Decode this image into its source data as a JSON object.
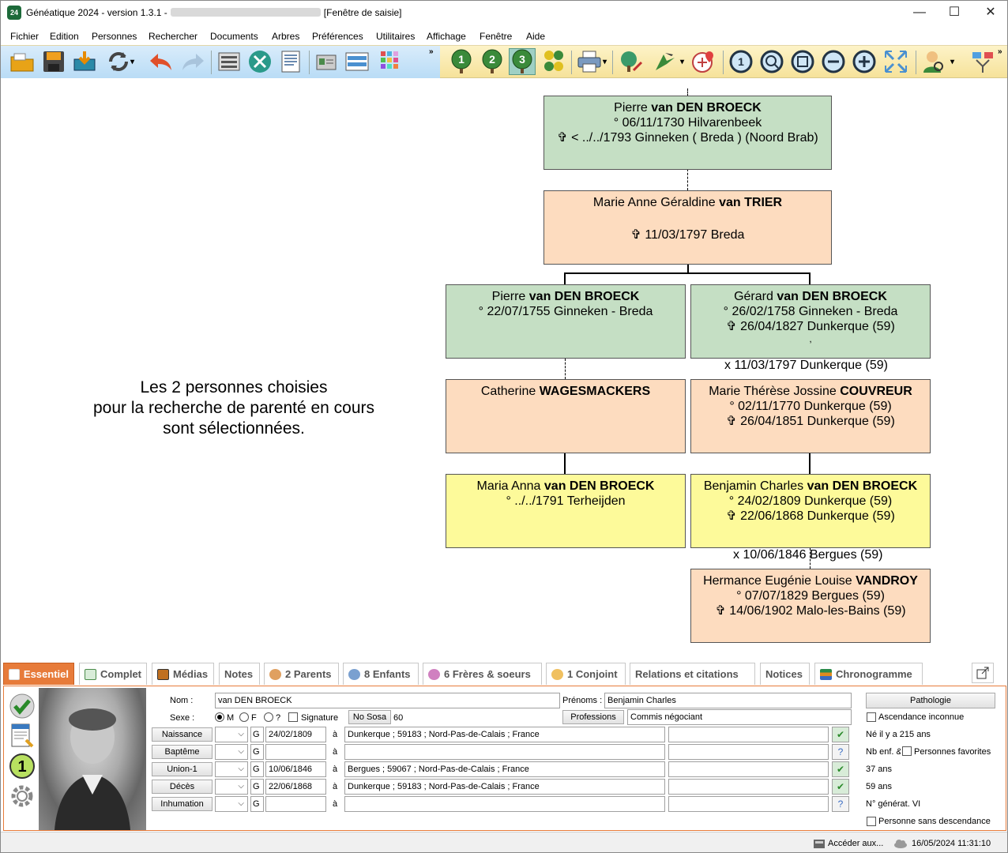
{
  "window": {
    "app_title": "Généatique 2024 - version 1.3.1 -",
    "title_suffix": "[Fenêtre de saisie]",
    "logo_text": "24",
    "minimize": "—",
    "maximize": "☐",
    "close": "✕"
  },
  "menu": [
    "Fichier",
    "Edition",
    "Personnes",
    "Rechercher",
    "Documents",
    "Arbres",
    "Préférences",
    "Utilitaires",
    "Affichage",
    "Fenêtre",
    "Aide"
  ],
  "toolbar": {
    "icons": [
      "open-folder-icon",
      "save-icon",
      "import-icon",
      "refresh-icon",
      "undo-icon",
      "redo-icon",
      "keyboard-icon",
      "tools-icon",
      "document-icon",
      "id-card-icon",
      "list-icon",
      "color-grid-icon",
      "generation-1-icon",
      "generation-2-icon",
      "generation-3-icon",
      "family-icon",
      "print-icon",
      "tree-edit-icon",
      "cursor-icon",
      "map-icon",
      "zoom-1-icon",
      "zoom-fit-icon",
      "zoom-frame-icon",
      "zoom-out-icon",
      "zoom-in-icon",
      "fullscreen-icon",
      "person-search-icon",
      "filter-icon"
    ],
    "overflow": "»",
    "gen1": "1",
    "gen2": "2",
    "gen3": "3"
  },
  "tree": {
    "persons": [
      {
        "first": "Pierre ",
        "last": "van DEN BROECK",
        "line2": "° 06/11/1730 Hilvarenbeek",
        "line3": "✞ < ../../1793 Ginneken ( Breda ) (Noord Brab)",
        "color": "green"
      },
      {
        "first": "Marie Anne Géraldine ",
        "last": "van TRIER",
        "line2": "",
        "line3": "✞ 11/03/1797 Breda",
        "color": "peach"
      },
      {
        "first": "Pierre ",
        "last": "van DEN BROECK",
        "line2": "° 22/07/1755 Ginneken - Breda",
        "line3": "",
        "color": "green"
      },
      {
        "first": "Gérard ",
        "last": "van DEN BROECK",
        "line2": "° 26/02/1758 Ginneken - Breda",
        "line3": "✞ 26/04/1827 Dunkerque (59)",
        "color": "green"
      },
      {
        "first": "Catherine ",
        "last": "WAGESMACKERS",
        "line2": "",
        "line3": "",
        "color": "peach"
      },
      {
        "first": "Marie Thérèse Jossine ",
        "last": "COUVREUR",
        "line2": "° 02/11/1770 Dunkerque (59)",
        "line3": "✞ 26/04/1851 Dunkerque (59)",
        "color": "peach"
      },
      {
        "first": "Maria Anna ",
        "last": "van DEN BROECK",
        "line2": "° ../../1791 Terheijden",
        "line3": "",
        "color": "yellow"
      },
      {
        "first": "Benjamin Charles ",
        "last": "van DEN BROECK",
        "line2": "° 24/02/1809 Dunkerque (59)",
        "line3": "✞ 22/06/1868 Dunkerque (59)",
        "color": "yellow"
      },
      {
        "first": "Hermance Eugénie Louise ",
        "last": "VANDROY",
        "line2": "° 07/07/1829 Bergues (59)",
        "line3": "✞ 14/06/1902 Malo-les-Bains (59)",
        "color": "peach"
      }
    ],
    "unions": [
      "x 11/03/1797 Dunkerque (59)",
      "x 10/06/1846 Bergues (59)"
    ],
    "comma": ",",
    "message": [
      "Les 2 personnes choisies",
      "pour la recherche de parenté en cours",
      "sont sélectionnées."
    ]
  },
  "tabs": [
    {
      "label": "Essentiel",
      "icon": "calendar-icon",
      "active": true
    },
    {
      "label": "Complet",
      "icon": "form-icon"
    },
    {
      "label": "Médias",
      "icon": "film-icon"
    },
    {
      "label": "Notes",
      "icon": ""
    },
    {
      "label": "2 Parents",
      "icon": "parents-icon"
    },
    {
      "label": "8 Enfants",
      "icon": "children-icon"
    },
    {
      "label": "6 Frères & soeurs",
      "icon": "siblings-icon"
    },
    {
      "label": "1 Conjoint",
      "icon": "spouse-icon"
    },
    {
      "label": "Relations et citations",
      "icon": ""
    },
    {
      "label": "Notices",
      "icon": ""
    },
    {
      "label": "Chronogramme",
      "icon": "chronogram-icon"
    }
  ],
  "form": {
    "nom_label": "Nom :",
    "nom": "van DEN BROECK",
    "prenoms_label": "Prénoms :",
    "prenoms": "Benjamin Charles",
    "sexe_label": "Sexe :",
    "sexe_m": "M",
    "sexe_f": "F",
    "sexe_q": "?",
    "signature": "Signature",
    "no_sosa": "No Sosa",
    "sosa": "60",
    "professions_btn": "Professions",
    "profession": "Commis négociant",
    "pathologie": "Pathologie",
    "a": "à",
    "g": "G",
    "events": [
      {
        "label": "Naissance",
        "date": "24/02/1809",
        "place": "Dunkerque ; 59183 ; Nord-Pas-de-Calais ; France"
      },
      {
        "label": "Baptême",
        "date": "",
        "place": ""
      },
      {
        "label": "Union-1",
        "date": "10/06/1846",
        "place": "Bergues ; 59067 ; Nord-Pas-de-Calais ; France"
      },
      {
        "label": "Décès",
        "date": "22/06/1868",
        "place": "Dunkerque ; 59183 ; Nord-Pas-de-Calais ; France"
      },
      {
        "label": "Inhumation",
        "date": "",
        "place": ""
      }
    ],
    "right": {
      "ascendance": "Ascendance inconnue",
      "age_now": "Né il y a 215 ans",
      "nb_enf": "Nb enf. &",
      "favorites": "Personnes favorites",
      "age_union": "37 ans",
      "age_death": "59 ans",
      "generation": "N° générat. VI",
      "sans_desc": "Personne sans descendance"
    }
  },
  "status": {
    "access": "Accéder aux...",
    "datetime": "16/05/2024 11:31:10"
  },
  "colors": {
    "green": "#c5dfc4",
    "peach": "#fddcbf",
    "yellow": "#fdfa9a",
    "accent": "#e77b3a"
  }
}
